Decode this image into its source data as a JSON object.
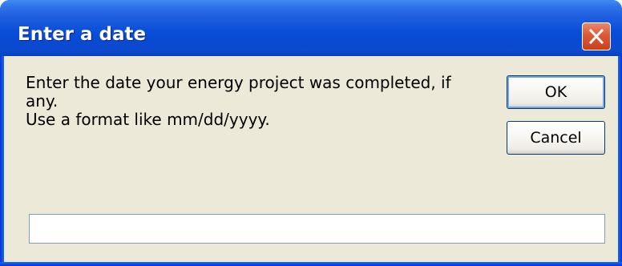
{
  "window": {
    "title": "Enter a date"
  },
  "prompt": {
    "line1": "Enter the date your energy project was completed, if",
    "line2": "any.",
    "line3": "Use a format like mm/dd/yyyy."
  },
  "buttons": {
    "ok_label": "OK",
    "cancel_label": "Cancel"
  },
  "input": {
    "value": ""
  },
  "icons": {
    "close": "close-icon"
  },
  "colors": {
    "titlebar": "#0a49d1",
    "client": "#ece9d8",
    "close_button": "#dc5a36"
  }
}
